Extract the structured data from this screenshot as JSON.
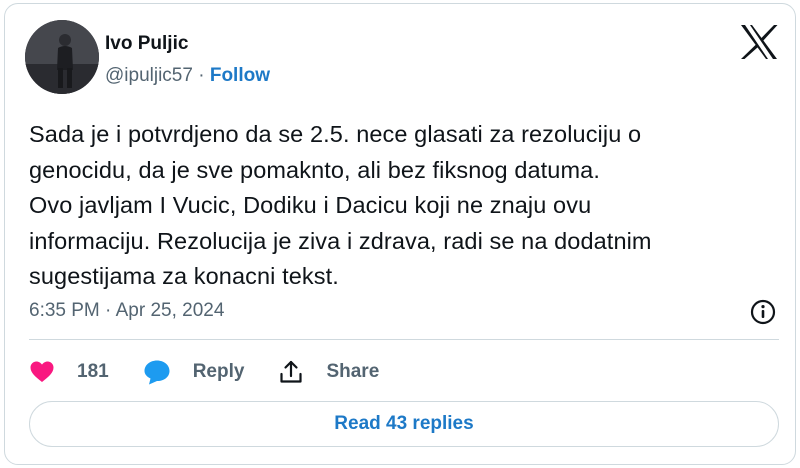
{
  "author": {
    "name": "Ivo Puljic",
    "handle": "@ipuljic57",
    "separator": "·",
    "follow_label": "Follow"
  },
  "tweet": {
    "lines": [
      "Sada je i potvrdjeno da se 2.5. nece glasati za rezoluciju o",
      "genocidu, da je sve pomaknto, ali bez fiksnog datuma.",
      "Ovo javljam I Vucic, Dodiku i Dacicu koji ne znaju ovu",
      "informaciju. Rezolucija je ziva i zdrava, radi se na dodatnim",
      "sugestijama za konacni tekst."
    ],
    "timestamp": "6:35 PM · Apr 25, 2024"
  },
  "actions": {
    "like_count": "181",
    "reply_label": "Reply",
    "share_label": "Share"
  },
  "read_replies_label": "Read 43 replies",
  "icons": {
    "brand": "x-logo-icon",
    "info": "info-icon",
    "like": "heart-icon",
    "reply": "speech-bubble-icon",
    "share": "share-upload-icon"
  },
  "colors": {
    "like": "#f91880",
    "reply": "#1d9bf0",
    "link": "#1d79c7",
    "secondary_text": "#536471",
    "border": "#cfd9de"
  }
}
